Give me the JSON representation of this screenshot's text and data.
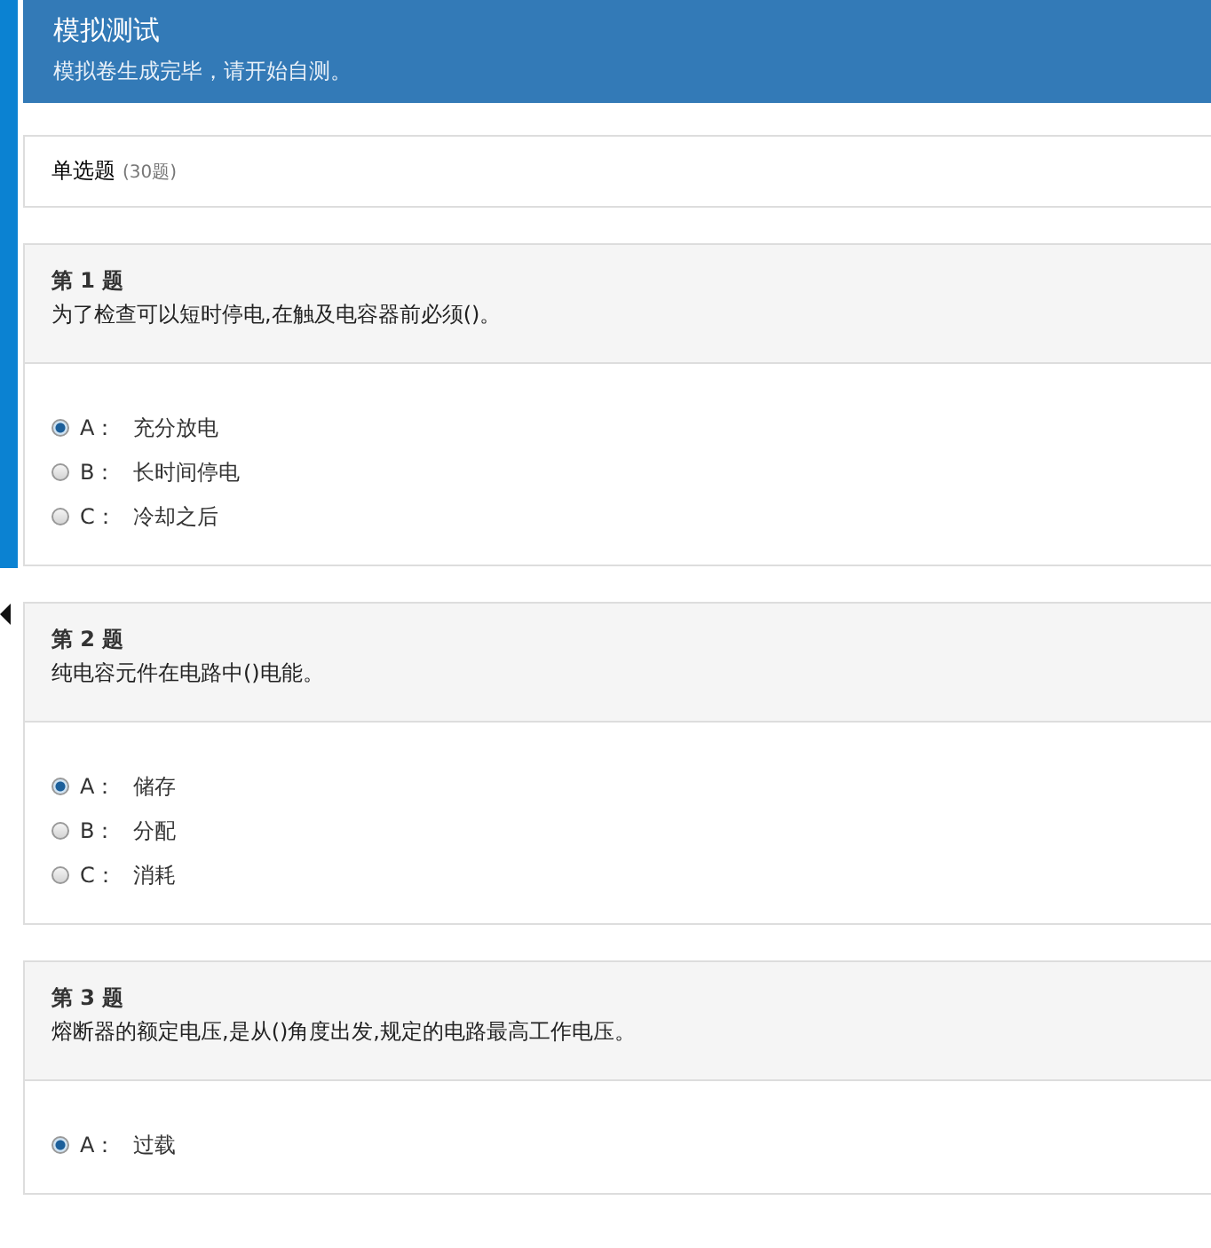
{
  "header": {
    "title": "模拟测试",
    "subtitle": "模拟卷生成完毕，请开始自测。"
  },
  "section": {
    "title": "单选题",
    "count": "(30题)"
  },
  "questions": [
    {
      "number": "第 1 题",
      "text": "为了检查可以短时停电,在触及电容器前必须()。",
      "options": [
        {
          "letter": "A：",
          "text": "充分放电",
          "selected": true
        },
        {
          "letter": "B：",
          "text": "长时间停电",
          "selected": false
        },
        {
          "letter": "C：",
          "text": "冷却之后",
          "selected": false
        }
      ]
    },
    {
      "number": "第 2 题",
      "text": "纯电容元件在电路中()电能。",
      "options": [
        {
          "letter": "A：",
          "text": "储存",
          "selected": true
        },
        {
          "letter": "B：",
          "text": "分配",
          "selected": false
        },
        {
          "letter": "C：",
          "text": "消耗",
          "selected": false
        }
      ]
    },
    {
      "number": "第 3 题",
      "text": "熔断器的额定电压,是从()角度出发,规定的电路最高工作电压。",
      "options": [
        {
          "letter": "A：",
          "text": "过载",
          "selected": true
        }
      ]
    }
  ]
}
